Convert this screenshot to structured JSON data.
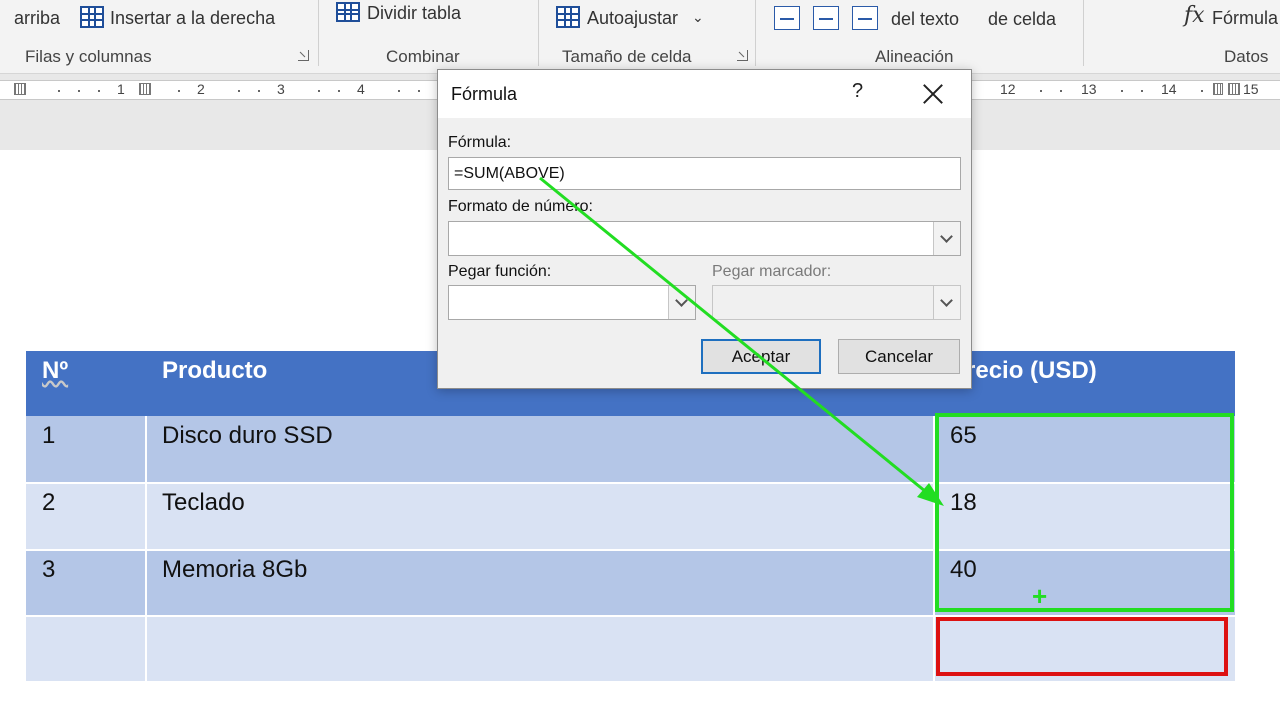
{
  "ribbon": {
    "insert_above": "arriba",
    "insert_right": "Insertar a la derecha",
    "split_table": "Dividir tabla",
    "autofit": "Autoajustar",
    "text_direction": "del texto",
    "cell_margins": "de celda",
    "formula": "Fórmula",
    "groups": {
      "rows_cols": "Filas y columnas",
      "merge": "Combinar",
      "cell_size": "Tamaño de celda",
      "alignment": "Alineación",
      "data": "Datos"
    }
  },
  "ruler": {
    "numbers_left": [
      "1",
      "2",
      "3",
      "4"
    ],
    "numbers_right": [
      "12",
      "13",
      "14",
      "15"
    ]
  },
  "table": {
    "headers": [
      "Nº",
      "Producto",
      "Precio (USD)"
    ],
    "rows": [
      [
        "1",
        "Disco duro SSD",
        "65"
      ],
      [
        "2",
        "Teclado",
        "18"
      ],
      [
        "3",
        "Memoria 8Gb",
        "40"
      ],
      [
        "",
        "",
        ""
      ]
    ]
  },
  "dialog": {
    "title": "Fórmula",
    "help": "?",
    "formula_label": "Fórmula:",
    "formula_value": "=SUM(ABOVE)",
    "number_format_label": "Formato de número:",
    "number_format_value": "",
    "paste_function_label": "Pegar función:",
    "paste_function_value": "",
    "paste_bookmark_label": "Pegar marcador:",
    "paste_bookmark_value": "",
    "ok_label": "Aceptar",
    "cancel_label": "Cancelar"
  },
  "annotations": {
    "plus_sign": "+",
    "colors": {
      "highlight": "#22dd22",
      "target": "#dd1111"
    }
  },
  "colors": {
    "table_header": "#4472c4",
    "row_band_dark": "#b4c6e7",
    "row_band_light": "#d9e2f3",
    "default_button_border": "#1e6fbf"
  }
}
